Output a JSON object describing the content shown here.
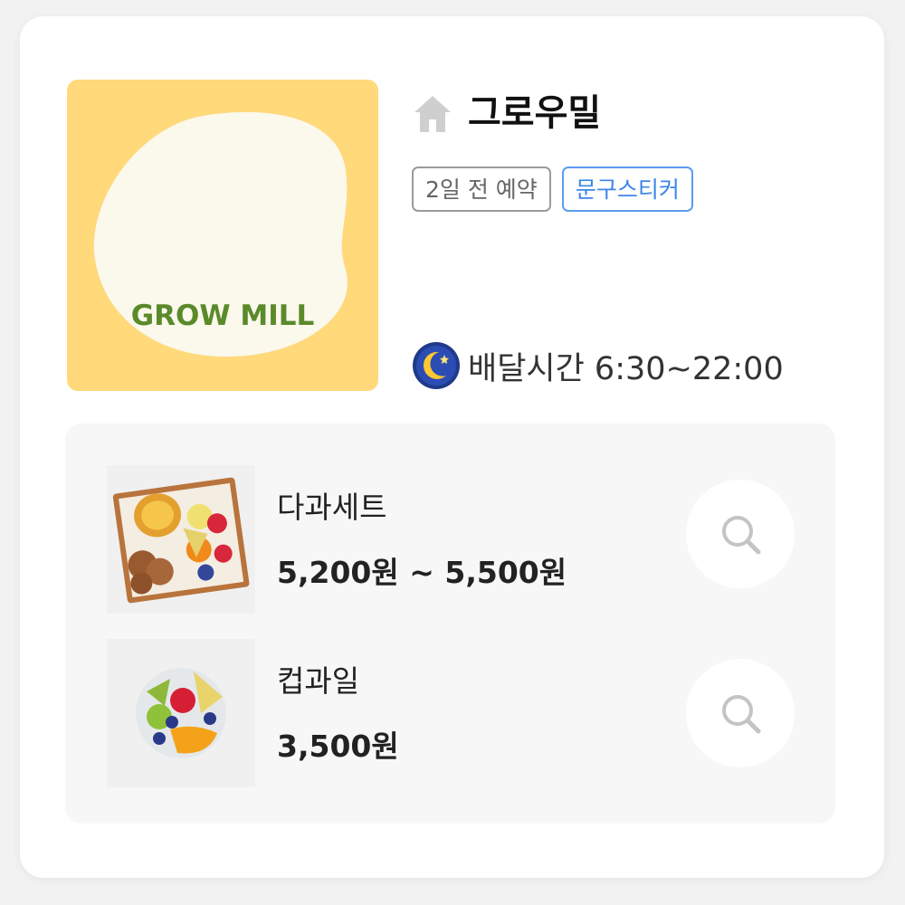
{
  "store": {
    "logo_text": "GROW MILL",
    "name": "그로우밀",
    "home_icon": "home-icon",
    "tags": [
      {
        "label": "2일 전 예약",
        "style": "grey"
      },
      {
        "label": "문구스티커",
        "style": "blue"
      }
    ],
    "delivery": {
      "icon": "moon-icon",
      "label": "배달시간 6:30~22:00"
    }
  },
  "menu": {
    "items": [
      {
        "name": "다과세트",
        "price": "5,200원 ~ 5,500원",
        "thumb": "snack-set-image",
        "action_icon": "search-icon"
      },
      {
        "name": "컵과일",
        "price": "3,500원",
        "thumb": "cup-fruit-image",
        "action_icon": "search-icon"
      }
    ]
  },
  "colors": {
    "logo_bg": "#ffd97a",
    "logo_text": "#5a8a2a",
    "tag_grey": "#9b9b9b",
    "tag_blue": "#3d86ea",
    "panel_bg": "#f7f7f7"
  }
}
